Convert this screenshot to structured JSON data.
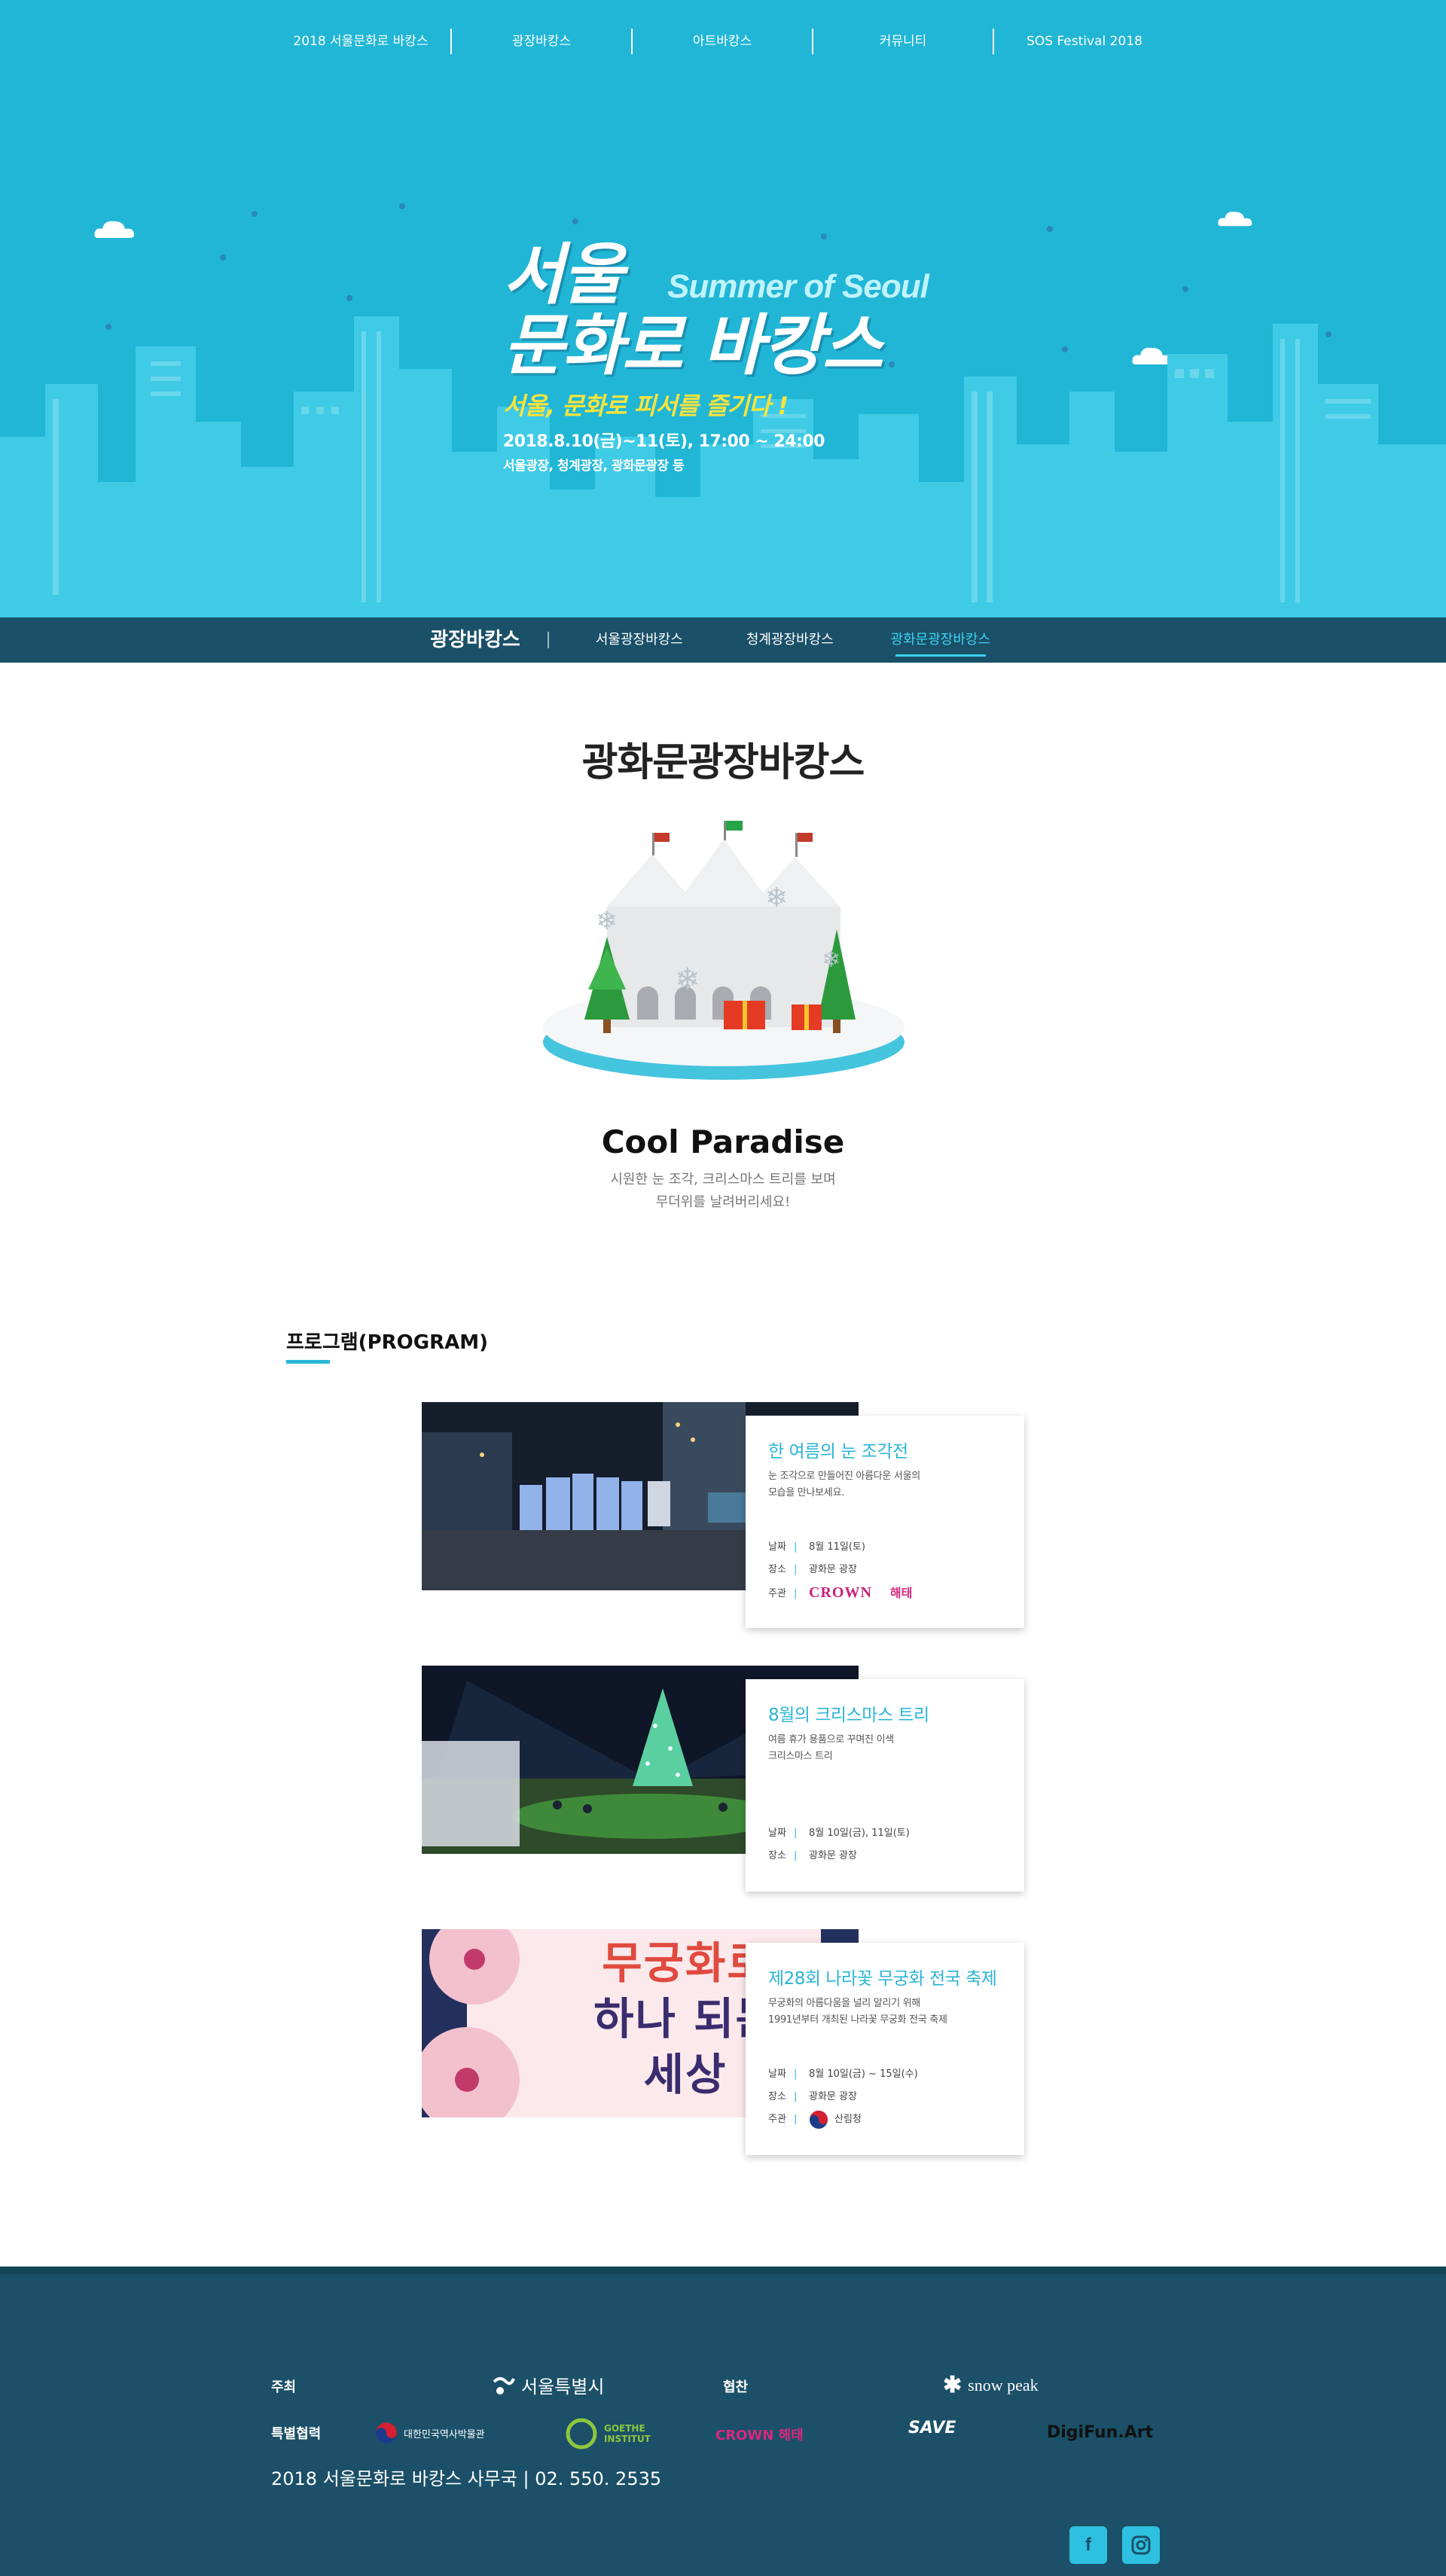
{
  "top_nav": [
    "2018 서울문화로 바캉스",
    "광장바캉스",
    "아트바캉스",
    "커뮤니티",
    "SOS Festival 2018"
  ],
  "hero": {
    "title_ko": "서울\n문화로 바캉스",
    "title_ko_line1": "서울",
    "title_ko_line2": "문화로 바캉스",
    "title_en": "Summer of Seoul",
    "slogan": "서울, 문화로 피서를 즐기다 !",
    "date": "2018.8.10(금)~11(토), 17:00 ~ 24:00",
    "place": "서울광장, 청계광장, 광화문광장 등",
    "colors": {
      "sky": "#21b6d6",
      "building": "#3fcbe6",
      "slogan": "#f6e43c"
    }
  },
  "sub_nav": {
    "title": "광장바캉스",
    "items": [
      {
        "label": "서울광장바캉스",
        "active": false
      },
      {
        "label": "청계광장바캉스",
        "active": false
      },
      {
        "label": "광화문광장바캉스",
        "active": true
      }
    ]
  },
  "main": {
    "section_title": "광화문광장바캉스",
    "feature_title": "Cool Paradise",
    "feature_desc": "시원한 눈 조각, 크리스마스 트리를 보며\n무더위를 날려버리세요!",
    "program_heading": "프로그램(PROGRAM)"
  },
  "programs": [
    {
      "title": "한 여름의 눈 조각전",
      "desc": "눈 조각으로 만들어진 아름다운 서울의\n모습을 만나보세요.",
      "meta": [
        {
          "label": "날짜",
          "value": "8월 11일(토)"
        },
        {
          "label": "장소",
          "value": "광화문 광장"
        },
        {
          "label": "주관",
          "value": ""
        }
      ],
      "sponsor_logos": [
        "CROWN",
        "해태"
      ],
      "photo": "night-snow-sculptures"
    },
    {
      "title": "8월의 크리스마스 트리",
      "desc": "여름 휴가 용품으로 꾸며진 이색\n크리스마스 트리",
      "meta": [
        {
          "label": "날짜",
          "value": "8월 10일(금), 11일(토)"
        },
        {
          "label": "장소",
          "value": "광화문 광장"
        }
      ],
      "photo": "night-christmas-tree"
    },
    {
      "title": "제28회 나라꽃 무궁화 전국 축제",
      "desc": "무궁화의 아름다움을 널리 알리기 위해\n1991년부터 개최된 나라꽃 무궁화 전국 축제",
      "meta": [
        {
          "label": "날짜",
          "value": "8월 10일(금) ~ 15일(수)"
        },
        {
          "label": "장소",
          "value": "광화문 광장"
        },
        {
          "label": "주관",
          "value": "산림청"
        }
      ],
      "poster_text": "무궁화로\n하나 되는\n세상",
      "poster_line1": "무궁화로",
      "poster_line2": "하나 되는",
      "poster_line3": "세상",
      "photo": "mugunghwa-poster"
    }
  ],
  "footer": {
    "host_label": "주최",
    "host_logo": "서울특별시",
    "sponsor_label": "협찬",
    "sponsor_logo": "snow peak",
    "special_label": "특별협력",
    "partners": [
      "대한민국역사박물관",
      "GOETHE INSTITUT",
      "CROWN 해태",
      "SAVE",
      "DigiFun.Art"
    ],
    "address": "2018 서울문화로 바캉스 사무국 | 02. 550. 2535",
    "sns": [
      "facebook-icon",
      "instagram-icon"
    ]
  }
}
